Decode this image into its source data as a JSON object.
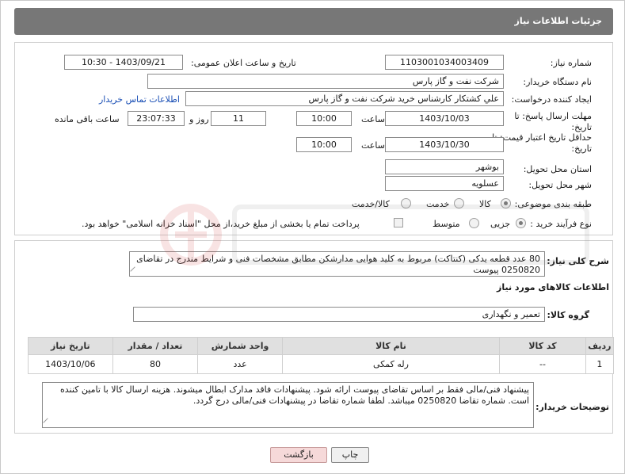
{
  "page": {
    "title": "جزئیات اطلاعات نیاز"
  },
  "fields": {
    "need_number_label": "شماره نیاز:",
    "need_number": "1103001034003409",
    "announce_label": "تاریخ و ساعت اعلان عمومی:",
    "announce_value": "1403/09/21 - 10:30",
    "buyer_org_label": "نام دستگاه خریدار:",
    "buyer_org": "شرکت نفت و گاز پارس",
    "creator_label": "ایجاد کننده درخواست:",
    "creator": "علي کشتکار کارشناس خريد شرکت نفت و گاز پارس",
    "contact_link": "اطلاعات تماس خریدار",
    "reply_deadline_label": "مهلت ارسال پاسخ: تا تاریخ:",
    "reply_date": "1403/10/03",
    "time_label": "ساعت",
    "reply_time": "10:00",
    "days_value": "11",
    "days_label": "روز و",
    "remaining_time": "23:07:33",
    "remaining_label": "ساعت باقی مانده",
    "validity_label": "حداقل تاریخ اعتبار قیمت: تا تاریخ:",
    "validity_date": "1403/10/30",
    "validity_time": "10:00",
    "province_label": "استان محل تحویل:",
    "province": "بوشهر",
    "city_label": "شهر محل تحویل:",
    "city": "عسلويه",
    "category_label": "طبقه بندی موضوعی:",
    "category_options": [
      "کالا",
      "خدمت",
      "کالا/خدمت"
    ],
    "category_selected": "کالا",
    "process_label": "نوع فرآیند خرید :",
    "process_options": [
      "جزیی",
      "متوسط"
    ],
    "process_selected": "جزیی",
    "payment_note": "پرداخت تمام یا بخشی از مبلغ خرید،از محل \"اسناد خزانه اسلامی\" خواهد بود."
  },
  "description": {
    "label": "شرح کلی نیاز:",
    "text": "80 عدد قطعه یدکی (کنتاکت) مربوط به کلید هوایی مدارشکن مطابق مشخصات فنی و شرایط مندرج در تقاضای 0250820 پیوست"
  },
  "goods": {
    "section_title": "اطلاعات کالاهای مورد نیاز",
    "group_label": "گروه کالا:",
    "group_value": "تعمیر و نگهداری",
    "columns": [
      "ردیف",
      "کد کالا",
      "نام کالا",
      "واحد شمارش",
      "تعداد / مقدار",
      "تاریخ نیاز"
    ],
    "rows": [
      {
        "index": "1",
        "code": "--",
        "name": "رله کمکی",
        "unit": "عدد",
        "qty": "80",
        "date": "1403/10/06"
      }
    ]
  },
  "buyer_notes": {
    "label": "توضیحات خریدار:",
    "text": "پیشنهاد فنی/مالی فقط بر اساس تقاضای پیوست ارائه شود. پیشنهادات فاقد مدارک ابطال میشوند. هزینه ارسال کالا با تامین کننده است. شماره تقاضا 0250820  میباشد. لطفا شماره تقاضا در پیشنهادات فنی/مالی درج گردد."
  },
  "buttons": {
    "print": "چاپ",
    "back": "بازگشت"
  },
  "colors": {
    "header_bg": "#777777",
    "back_button_bg": "#f6d9d9",
    "link": "#1a4fb5"
  }
}
